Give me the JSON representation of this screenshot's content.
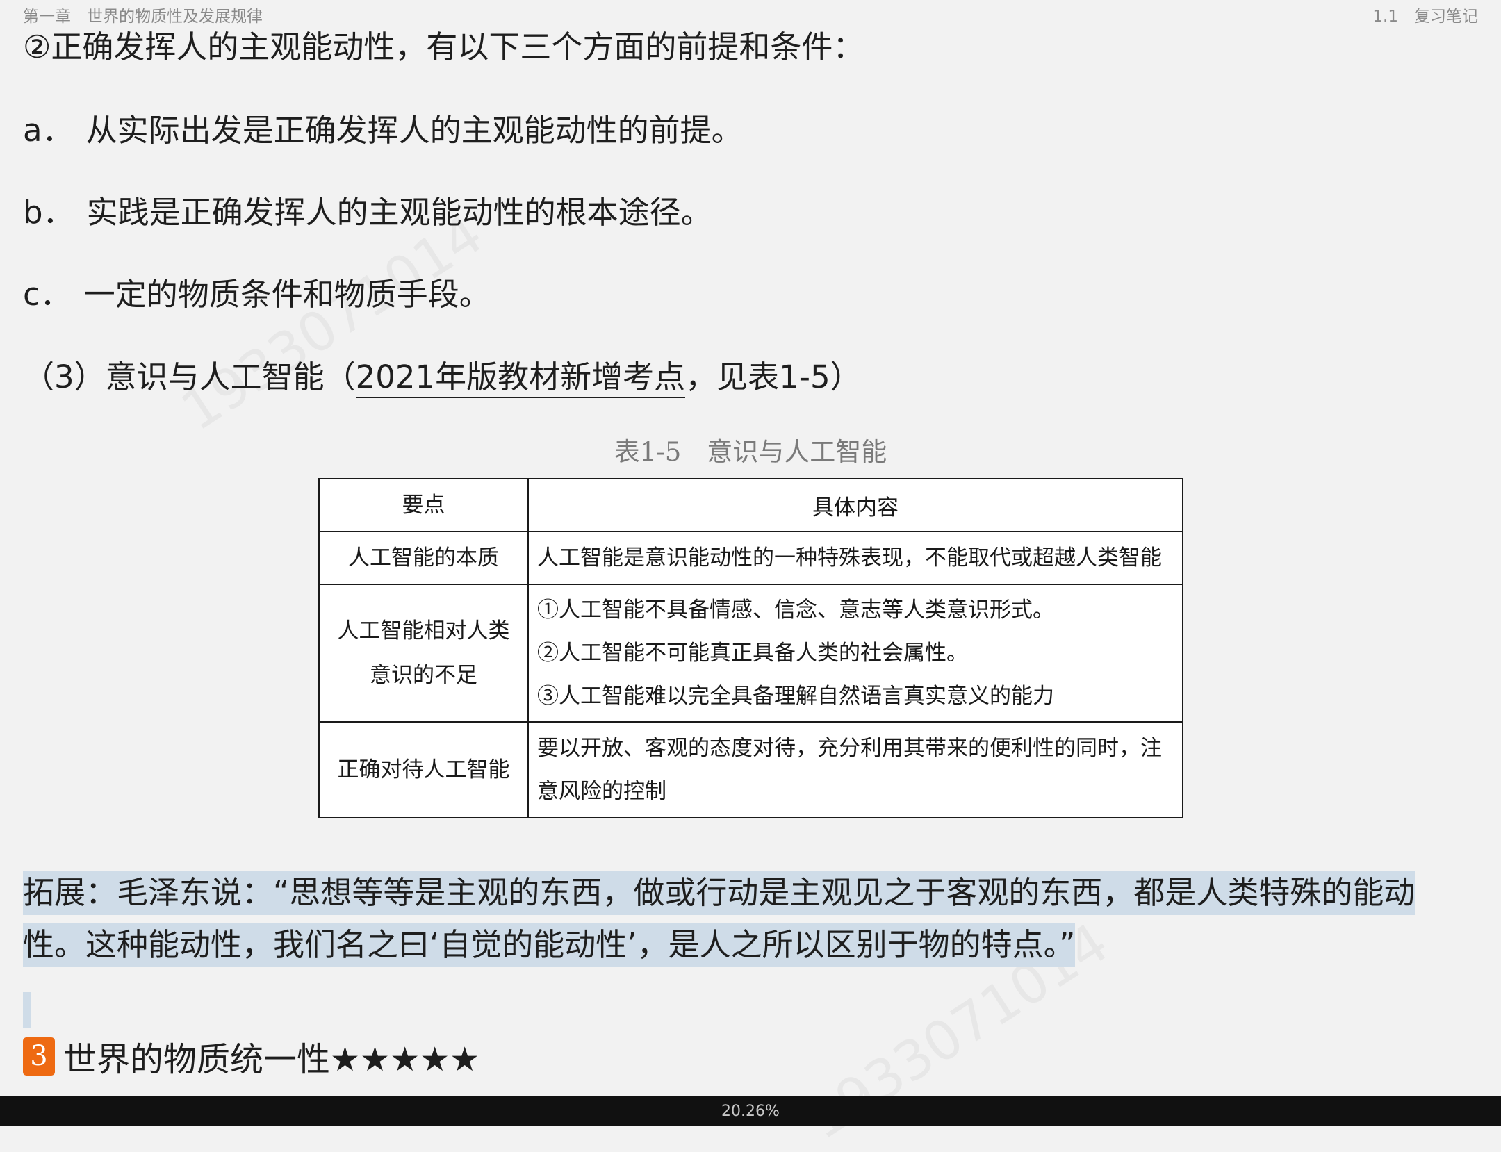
{
  "header": {
    "chapter": "第一章　世界的物质性及发展规律",
    "section": "1.1　复习笔记"
  },
  "paragraphs": {
    "p1": "②正确发挥人的主观能动性，有以下三个方面的前提和条件：",
    "pa_marker": "a．",
    "pa": "从实际出发是正确发挥人的主观能动性的前提。",
    "pb_marker": "b．",
    "pb": "实践是正确发挥人的主观能动性的根本途径。",
    "pc_marker": "c．",
    "pc": "一定的物质条件和物质手段。",
    "p3_pre": "（3）意识与人工智能（",
    "p3_underline": "2021年版教材新增考点",
    "p3_post": "，见表1-5）"
  },
  "table": {
    "caption": "表1-5　意识与人工智能",
    "headers": [
      "要点",
      "具体内容"
    ],
    "rows": [
      {
        "key": "人工智能的本质",
        "lines": [
          "人工智能是意识能动性的一种特殊表现，不能取代或超越人类智能"
        ]
      },
      {
        "key_lines": [
          "人工智能相对人类",
          "意识的不足"
        ],
        "lines": [
          "①人工智能不具备情感、信念、意志等人类意识形式。",
          "②人工智能不可能真正具备人类的社会属性。",
          "③人工智能难以完全具备理解自然语言真实意义的能力"
        ]
      },
      {
        "key": "正确对待人工智能",
        "lines": [
          "要以开放、客观的态度对待，充分利用其带来的便利性的同时，注",
          "意风险的控制"
        ]
      }
    ]
  },
  "highlight": {
    "text": "拓展：毛泽东说：“思想等等是主观的东西，做或行动是主观见之于客观的东西，都是人类特殊的能动性。这种能动性，我们名之曰‘自觉的能动性’，是人之所以区别于物的特点。”"
  },
  "section": {
    "number": "3",
    "title": "世界的物质统一性★★★★★"
  },
  "progress": {
    "percent_label": "20.26%",
    "value": 0.2026
  },
  "colors": {
    "background": "#f2f2f2",
    "highlight": "#cfdce8",
    "section_badge": "#ee6a12",
    "bottom_bar": "#111111"
  }
}
